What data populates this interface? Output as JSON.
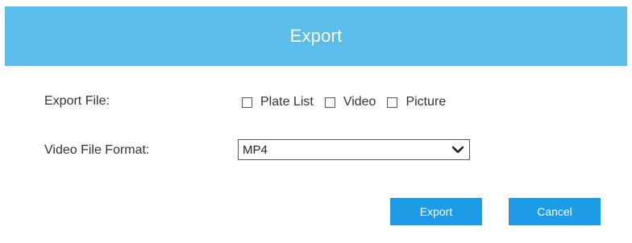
{
  "dialog": {
    "title": "Export"
  },
  "export_file": {
    "label": "Export File:",
    "options": [
      {
        "label": "Plate List",
        "checked": false
      },
      {
        "label": "Video",
        "checked": false
      },
      {
        "label": "Picture",
        "checked": false
      }
    ]
  },
  "video_format": {
    "label": "Video File Format:",
    "selected": "MP4"
  },
  "buttons": {
    "export_label": "Export",
    "cancel_label": "Cancel"
  },
  "colors": {
    "header": "#5bbde9",
    "button": "#1e9be6"
  }
}
